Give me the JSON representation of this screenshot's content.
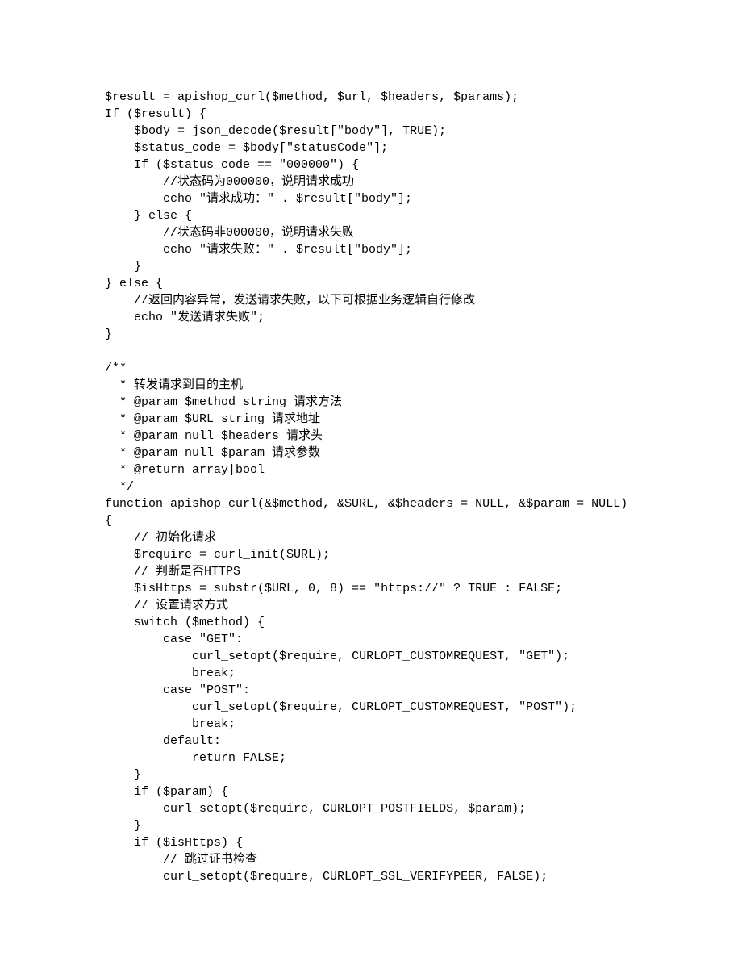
{
  "code": "$result = apishop_curl($method, $url, $headers, $params);\nIf ($result) {\n    $body = json_decode($result[\"body\"], TRUE);\n    $status_code = $body[\"statusCode\"];\n    If ($status_code == \"000000\") {\n        //状态码为000000，说明请求成功\n        echo \"请求成功：\" . $result[\"body\"];\n    } else {\n        //状态码非000000，说明请求失败\n        echo \"请求失败：\" . $result[\"body\"];\n    }\n} else {\n    //返回内容异常，发送请求失败，以下可根据业务逻辑自行修改\n    echo \"发送请求失败\";\n}\n\n/**\n  * 转发请求到目的主机\n  * @param $method string 请求方法\n  * @param $URL string 请求地址\n  * @param null $headers 请求头\n  * @param null $param 请求参数\n  * @return array|bool\n  */\nfunction apishop_curl(&$method, &$URL, &$headers = NULL, &$param = NULL)\n{\n    // 初始化请求\n    $require = curl_init($URL);\n    // 判断是否HTTPS\n    $isHttps = substr($URL, 0, 8) == \"https://\" ? TRUE : FALSE;\n    // 设置请求方式\n    switch ($method) {\n        case \"GET\":\n            curl_setopt($require, CURLOPT_CUSTOMREQUEST, \"GET\");\n            break;\n        case \"POST\":\n            curl_setopt($require, CURLOPT_CUSTOMREQUEST, \"POST\");\n            break;\n        default:\n            return FALSE;\n    }\n    if ($param) {\n        curl_setopt($require, CURLOPT_POSTFIELDS, $param);\n    }\n    if ($isHttps) {\n        // 跳过证书检查\n        curl_setopt($require, CURLOPT_SSL_VERIFYPEER, FALSE);"
}
